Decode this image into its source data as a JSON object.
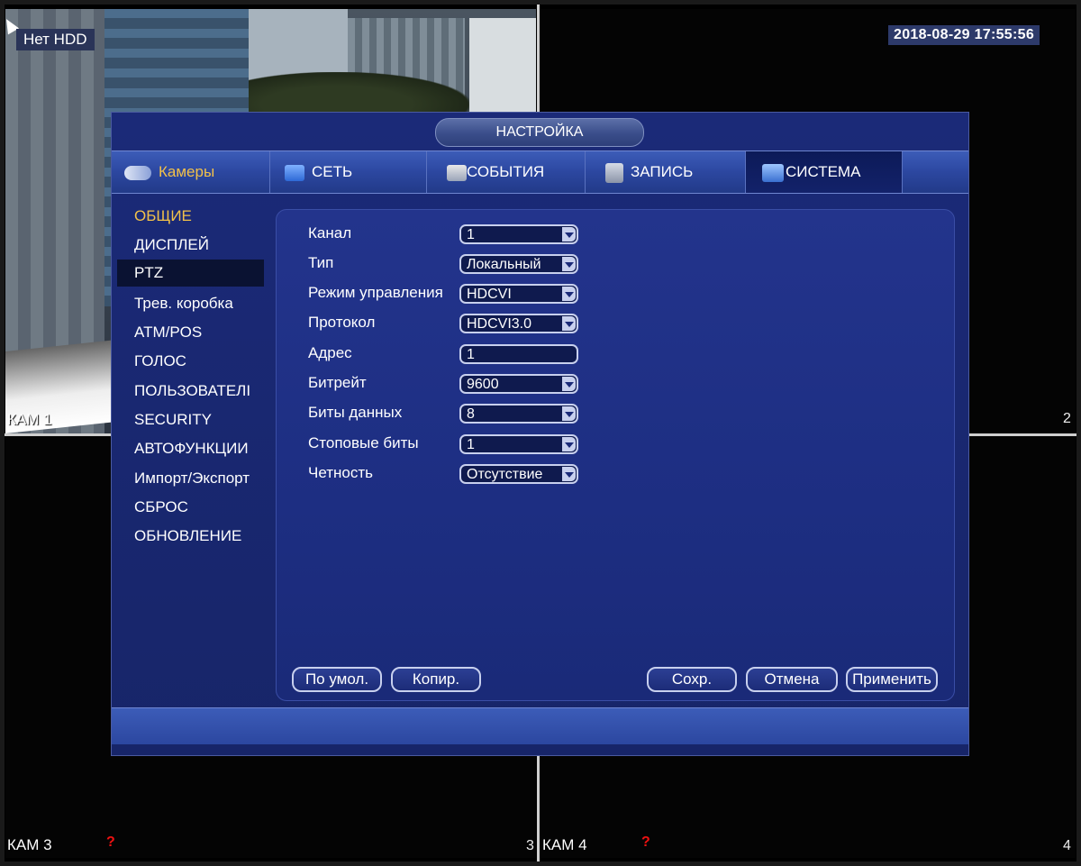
{
  "overlay": {
    "hdd_status": "Нет HDD",
    "datetime": "2018-08-29 17:55:56"
  },
  "cameras": [
    {
      "label": "КАМ 1",
      "num": "1"
    },
    {
      "label": "",
      "num": "2"
    },
    {
      "label": "КАМ 3",
      "num": "3"
    },
    {
      "label": "КАМ 4",
      "num": "4"
    }
  ],
  "window": {
    "title": "НАСТРОЙКА"
  },
  "tabs": [
    {
      "label": "Камеры",
      "icon": "camera-icon"
    },
    {
      "label": "СЕТЬ",
      "icon": "network-icon"
    },
    {
      "label": "СОБЫТИЯ",
      "icon": "events-icon"
    },
    {
      "label": "ЗАПИСЬ",
      "icon": "record-icon"
    },
    {
      "label": "СИСТЕМА",
      "icon": "system-icon",
      "active": true
    }
  ],
  "sidebar": {
    "items": [
      {
        "label": "ОБЩИЕ"
      },
      {
        "label": "ДИСПЛЕЙ"
      },
      {
        "label": "PTZ",
        "active": true
      },
      {
        "label": "Трев. коробка"
      },
      {
        "label": "ATM/POS"
      },
      {
        "label": "ГОЛОС"
      },
      {
        "label": "ПОЛЬЗОВАТЕЛІ"
      },
      {
        "label": "SECURITY"
      },
      {
        "label": "АВТОФУНКЦИИ"
      },
      {
        "label": "Импорт/Экспорт"
      },
      {
        "label": "СБРОС"
      },
      {
        "label": "ОБНОВЛЕНИЕ"
      }
    ]
  },
  "ptz_form": {
    "rows": [
      {
        "label": "Канал",
        "value": "1",
        "dropdown": true
      },
      {
        "label": "Тип",
        "value": "Локальный",
        "dropdown": true
      },
      {
        "label": "Режим управления",
        "value": "HDCVI",
        "dropdown": true
      },
      {
        "label": "Протокол",
        "value": "HDCVI3.0",
        "dropdown": true
      },
      {
        "label": "Адрес",
        "value": "1",
        "dropdown": false
      },
      {
        "label": "Битрейт",
        "value": "9600",
        "dropdown": true
      },
      {
        "label": "Биты данных",
        "value": "8",
        "dropdown": true
      },
      {
        "label": "Стоповые биты",
        "value": "1",
        "dropdown": true
      },
      {
        "label": "Четность",
        "value": "Отсутствие",
        "dropdown": true
      }
    ]
  },
  "buttons": {
    "default": "По умол.",
    "copy": "Копир.",
    "save": "Сохр.",
    "cancel": "Отмена",
    "apply": "Применить"
  },
  "colors": {
    "window_bg": "#1b2a78",
    "tab_bar": "#2c47a0",
    "highlight_text": "#f2c14a",
    "status_error": "#ee1111"
  }
}
